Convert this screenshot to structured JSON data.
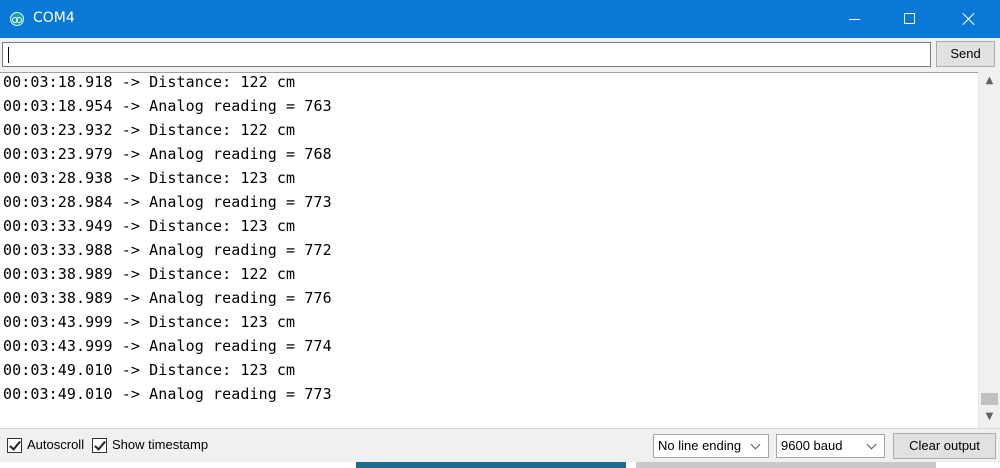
{
  "window": {
    "title": "COM4",
    "icon": "arduino-infinity-icon"
  },
  "input": {
    "value": "",
    "send_label": "Send"
  },
  "log_lines": [
    "00:03:18.918 -> Distance: 122 cm",
    "00:03:18.954 -> Analog reading = 763",
    "00:03:23.932 -> Distance: 122 cm",
    "00:03:23.979 -> Analog reading = 768",
    "00:03:28.938 -> Distance: 123 cm",
    "00:03:28.984 -> Analog reading = 773",
    "00:03:33.949 -> Distance: 123 cm",
    "00:03:33.988 -> Analog reading = 772",
    "00:03:38.989 -> Distance: 122 cm",
    "00:03:38.989 -> Analog reading = 776",
    "00:03:43.999 -> Distance: 123 cm",
    "00:03:43.999 -> Analog reading = 774",
    "00:03:49.010 -> Distance: 123 cm",
    "00:03:49.010 -> Analog reading = 773"
  ],
  "scrollbar": {
    "up_glyph": "▲",
    "down_glyph": "▼"
  },
  "footer": {
    "autoscroll": {
      "label": "Autoscroll",
      "checked": true
    },
    "show_timestamp": {
      "label": "Show timestamp",
      "checked": true
    },
    "line_ending": {
      "selected": "No line ending"
    },
    "baud": {
      "selected": "9600 baud"
    },
    "clear_label": "Clear output"
  },
  "colors": {
    "titlebar": "#0a78d7",
    "background": "#f0f0f0"
  }
}
